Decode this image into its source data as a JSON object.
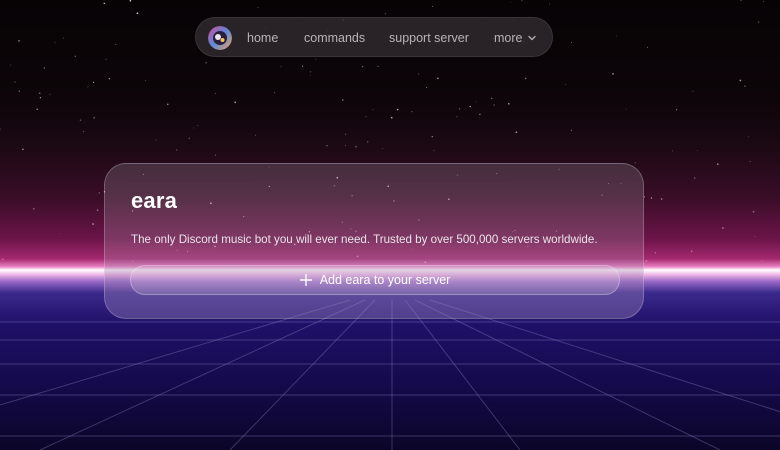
{
  "nav": {
    "logo_icon": "eara-avatar-icon",
    "links": [
      {
        "label": "home"
      },
      {
        "label": "commands"
      },
      {
        "label": "support server"
      },
      {
        "label": "more",
        "icon": "chevron-down-icon"
      }
    ]
  },
  "hero": {
    "title": "eara",
    "tagline": "The only Discord music bot you will ever need. Trusted by over 500,000 servers worldwide.",
    "cta": {
      "icon": "plus-icon",
      "label": "Add eara to your server"
    }
  },
  "colors": {
    "nav_background": "#2e282c",
    "nav_text": "#b9b2b6",
    "horizon_glow": "#e87cc0",
    "grid_floor": "#1f1068",
    "card_text": "#ffffff"
  }
}
